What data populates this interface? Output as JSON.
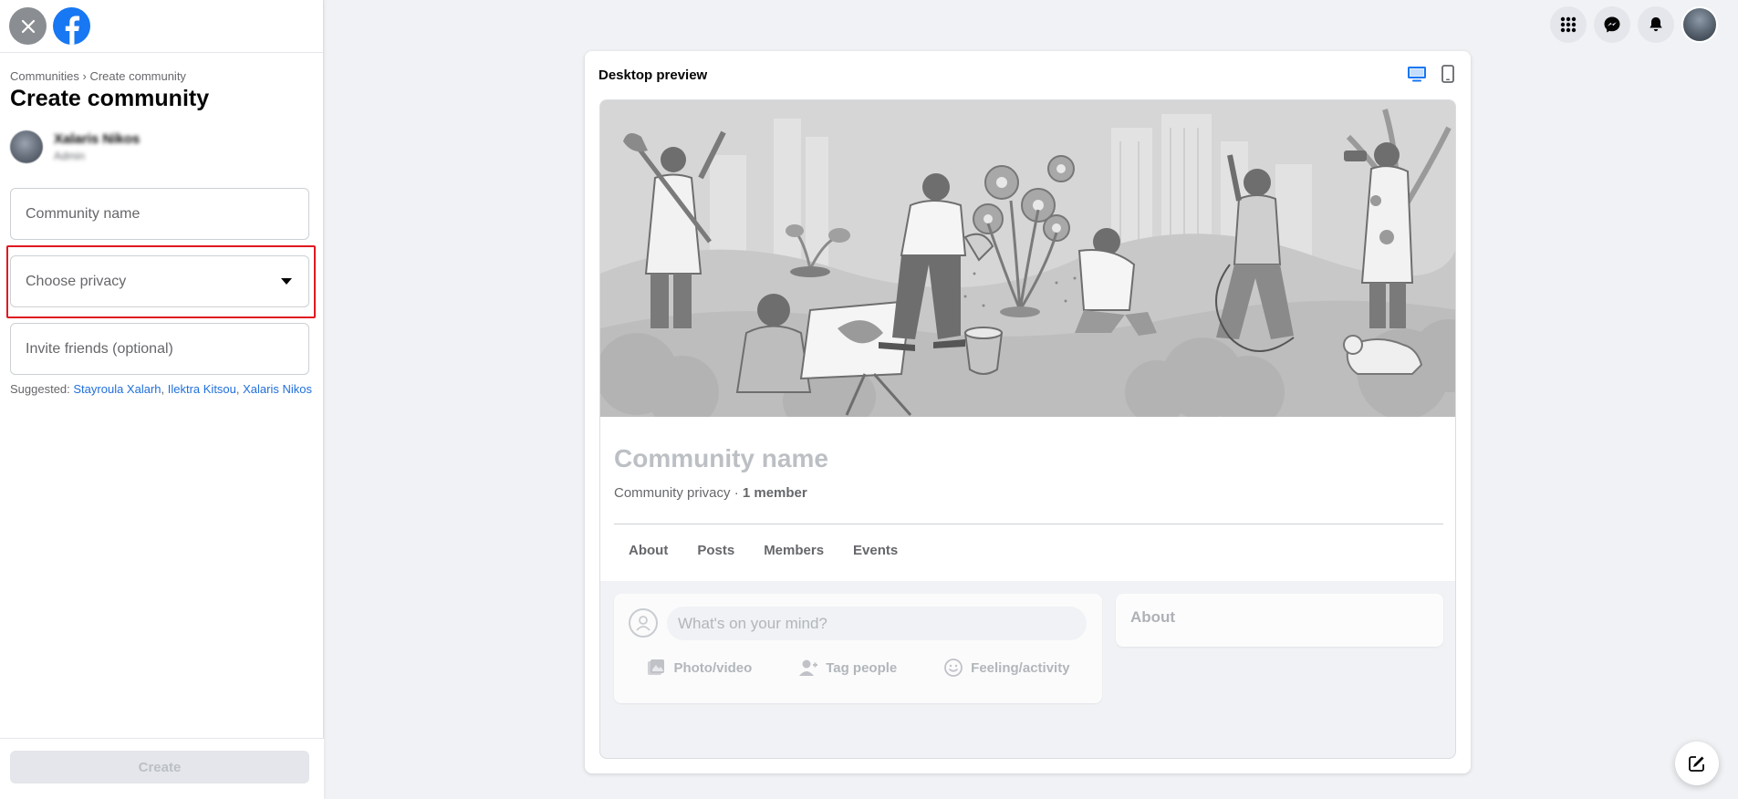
{
  "sidebar": {
    "breadcrumb": {
      "parent": "Communities",
      "separator": "›",
      "current": "Create community"
    },
    "title": "Create community",
    "admin": {
      "name": "Xalaris Nikos",
      "role": "Admin"
    },
    "fields": {
      "community_name_placeholder": "Community name",
      "privacy_placeholder": "Choose privacy",
      "invite_placeholder": "Invite friends (optional)"
    },
    "suggested": {
      "label": "Suggested: ",
      "names": [
        "Stayroula Xalarh",
        "Ilektra Kitsou",
        "Xalaris Nikos"
      ],
      "separator": ", "
    },
    "create_label": "Create"
  },
  "topbar": {
    "icons": [
      "menu-grid-icon",
      "messenger-icon",
      "notifications-bell-icon",
      "profile-avatar"
    ]
  },
  "preview": {
    "title": "Desktop preview",
    "devices": [
      "desktop-icon",
      "mobile-icon"
    ],
    "selected_device": "desktop",
    "community_name": "Community name",
    "privacy_text": "Community privacy · ",
    "members_text": "1 member",
    "tabs": [
      "About",
      "Posts",
      "Members",
      "Events"
    ],
    "composer": {
      "placeholder": "What's on your mind?",
      "actions": [
        "Photo/video",
        "Tag people",
        "Feeling/activity"
      ]
    },
    "about_title": "About"
  },
  "colors": {
    "accent": "#1877f2",
    "link": "#216fdb",
    "highlight": "#e0181f",
    "disabled_button": "#e4e6eb"
  }
}
